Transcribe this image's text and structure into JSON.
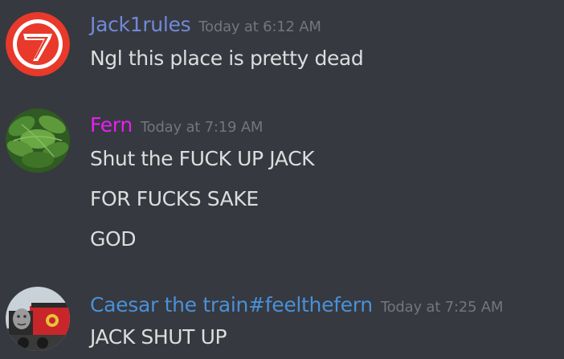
{
  "messages": [
    {
      "username": "Jack1rules",
      "username_color": "#7289da",
      "timestamp": "Today at 6:12 AM",
      "avatar": "red-circle-logo-icon",
      "lines": [
        "Ngl this place is pretty dead"
      ]
    },
    {
      "username": "Fern",
      "username_color": "#e91ef2",
      "timestamp": "Today at 7:19 AM",
      "avatar": "fern-plant-icon",
      "lines": [
        "Shut the FUCK UP JACK",
        "FOR FUCKS SAKE",
        "GOD"
      ]
    },
    {
      "username": "Caesar the train#feelthefern",
      "username_color": "#4a90d9",
      "timestamp": "Today at 7:25 AM",
      "avatar": "train-face-icon",
      "lines": [
        "JACK SHUT UP"
      ]
    }
  ],
  "colors": {
    "background": "#36393f",
    "message_text": "#dcddde",
    "timestamp": "#72767d"
  }
}
